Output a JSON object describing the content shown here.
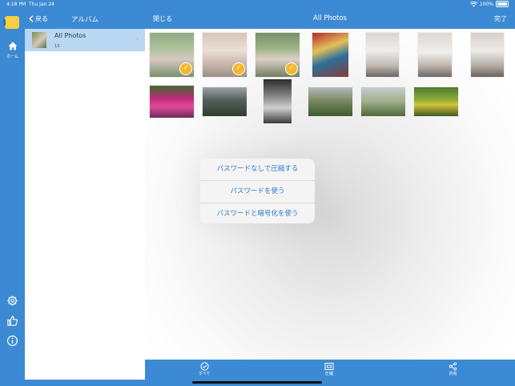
{
  "status_bar": {
    "time": "4:18 PM",
    "date": "Thu Jan 24",
    "battery": "100%"
  },
  "rail": {
    "home_label": "ホーム"
  },
  "sidebar": {
    "back_label": "戻る",
    "title": "アルバム",
    "albums": [
      {
        "name": "All Photos",
        "count": "13"
      }
    ]
  },
  "main": {
    "close_label": "閉じる",
    "title": "All Photos",
    "done_label": "完了"
  },
  "photos": [
    {
      "selected": true
    },
    {
      "selected": true
    },
    {
      "selected": true
    },
    {
      "selected": false
    },
    {
      "selected": false
    },
    {
      "selected": false
    },
    {
      "selected": false
    },
    {
      "selected": false
    },
    {
      "selected": false
    },
    {
      "selected": false
    },
    {
      "selected": false
    },
    {
      "selected": false
    },
    {
      "selected": false
    }
  ],
  "menu": {
    "items": [
      "パスワードなしで圧縮する",
      "パスワードを使う",
      "パスワードと暗号化を使う"
    ]
  },
  "toolbar": {
    "all_label": "すべて",
    "compress_label": "圧縮",
    "share_label": "共有"
  },
  "colors": {
    "accent": "#3c8ad3",
    "selected_row": "#b9d6f2",
    "check": "#f6b72a",
    "menu_text": "#2a7ad0"
  }
}
